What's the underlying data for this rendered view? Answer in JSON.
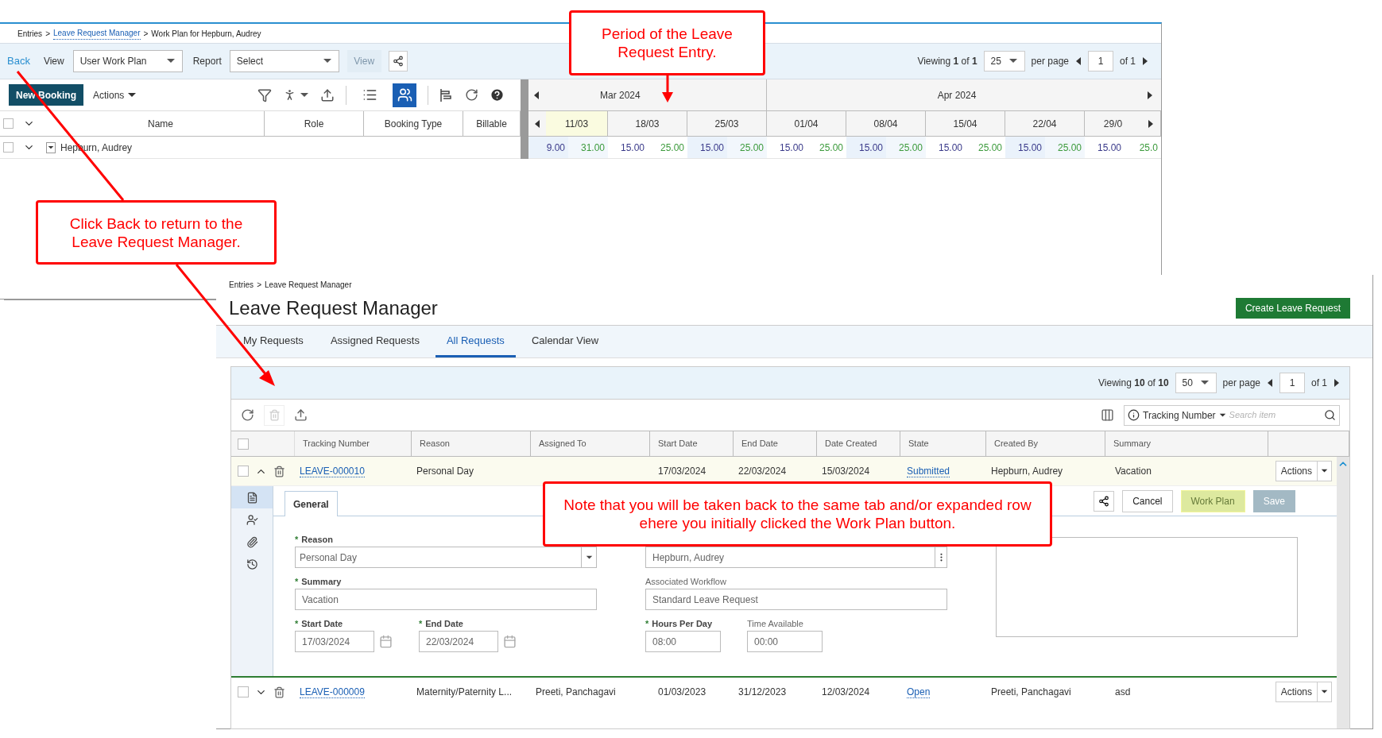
{
  "work_plan": {
    "breadcrumb": [
      {
        "text": "Entries",
        "link": false
      },
      {
        "text": "Leave Request Manager",
        "link": true
      },
      {
        "text": "Work Plan for Hepburn, Audrey",
        "link": false
      }
    ],
    "separator": ">",
    "toolbar": {
      "back": "Back",
      "view_label": "View",
      "view_value": "User Work Plan",
      "report_label": "Report",
      "report_value": "Select",
      "view_button": {
        "label": "View",
        "disabled": true
      }
    },
    "pager": {
      "viewing": "Viewing **1** of **1**",
      "per_page_value": "25",
      "per_page_label": "per page",
      "page": "1",
      "of": "of 1"
    },
    "new_booking": "New Booking",
    "actions": "Actions",
    "view_modes": [
      {
        "selected": false
      },
      {
        "selected": true
      }
    ],
    "columns": [
      "Name",
      "Role",
      "Booking Type",
      "Billable"
    ],
    "months": [
      "Mar 2024",
      "Apr 2024"
    ],
    "weeks": [
      {
        "label": "11/03",
        "current": true,
        "booked": "9.00",
        "available": "31.00"
      },
      {
        "label": "18/03",
        "current": false,
        "booked": "15.00",
        "available": "25.00"
      },
      {
        "label": "25/03",
        "current": false,
        "booked": "15.00",
        "available": "25.00"
      },
      {
        "label": "01/04",
        "current": false,
        "booked": "15.00",
        "available": "25.00"
      },
      {
        "label": "08/04",
        "current": false,
        "booked": "15.00",
        "available": "25.00"
      },
      {
        "label": "15/04",
        "current": false,
        "booked": "15.00",
        "available": "25.00"
      },
      {
        "label": "22/04",
        "current": false,
        "booked": "15.00",
        "available": "25.00"
      },
      {
        "label": "29/0",
        "current": false,
        "booked": "15.00",
        "available": "25.0"
      }
    ],
    "select_all": {
      "checked": false
    },
    "row": {
      "name": "Hepburn, Audrey",
      "checked": false
    }
  },
  "leave_manager": {
    "breadcrumb": [
      {
        "text": "Entries",
        "link": false
      },
      {
        "text": "Leave Request Manager",
        "link": false
      }
    ],
    "separator": ">",
    "title": "Leave Request Manager",
    "create_button": "Create Leave Request",
    "tabs": [
      {
        "label": "My Requests",
        "selected": false
      },
      {
        "label": "Assigned Requests",
        "selected": false
      },
      {
        "label": "All Requests",
        "selected": true
      },
      {
        "label": "Calendar View",
        "selected": false
      }
    ],
    "pager": {
      "viewing": "Viewing **10** of **10**",
      "per_page_value": "50",
      "per_page_label": "per page",
      "page": "1",
      "of": "of 1"
    },
    "search": {
      "field": "Tracking Number",
      "placeholder": "Search item"
    },
    "select_all": {
      "checked": false
    },
    "columns": [
      "Tracking Number",
      "Reason",
      "Assigned To",
      "Start Date",
      "End Date",
      "Date Created",
      "State",
      "Created By",
      "Summary"
    ],
    "rows": [
      {
        "checked": false,
        "expanded": true,
        "tracking": "LEAVE-000010",
        "reason": "Personal Day",
        "start": "17/03/2024",
        "end": "22/03/2024",
        "created": "15/03/2024",
        "state": "Submitted",
        "created_by": "Hepburn, Audrey",
        "summary": "Vacation",
        "actions": "Actions"
      },
      {
        "checked": false,
        "expanded": false,
        "tracking": "LEAVE-000009",
        "reason": "Maternity/Paternity L...",
        "assigned_to": "Preeti, Panchagavi",
        "start": "01/03/2023",
        "end": "31/12/2023",
        "created": "12/03/2024",
        "state": "Open",
        "created_by": "Preeti, Panchagavi",
        "summary": "asd",
        "actions": "Actions"
      }
    ],
    "detail": {
      "side_tabs": [
        {
          "selected": true
        },
        {
          "selected": false
        },
        {
          "selected": false
        },
        {
          "selected": false
        }
      ],
      "tab": {
        "label": "General",
        "selected": true
      },
      "buttons": [
        {
          "label": "Cancel",
          "highlighted": false,
          "disabled": false
        },
        {
          "label": "Work Plan",
          "highlighted": true,
          "disabled": false
        },
        {
          "label": "Save",
          "highlighted": false,
          "disabled": true
        }
      ],
      "required_mark": "*",
      "left": [
        {
          "kind": "select",
          "label": "Reason",
          "required": true,
          "value": "Personal Day"
        },
        {
          "kind": "text",
          "label": "Summary",
          "required": true,
          "value": "Vacation"
        },
        {
          "kind": "pair",
          "fields": [
            {
              "kind": "date",
              "label": "Start Date",
              "required": true,
              "value": "17/03/2024"
            },
            {
              "kind": "date",
              "label": "End Date",
              "required": true,
              "value": "22/03/2024"
            }
          ]
        }
      ],
      "right": [
        {
          "kind": "lookup",
          "value": "Hepburn, Audrey"
        },
        {
          "kind": "text",
          "label": "Associated Workflow",
          "required": false,
          "value": "Standard Leave Request"
        },
        {
          "kind": "pair",
          "fields": [
            {
              "kind": "short",
              "label": "Hours Per Day",
              "required": true,
              "value": "08:00"
            },
            {
              "kind": "short",
              "label": "Time Available",
              "required": false,
              "value": "00:00"
            }
          ]
        }
      ]
    }
  },
  "callouts": [
    {
      "text": "Period of the Leave Request Entry."
    },
    {
      "text": "Click Back to return to the Leave Request Manager."
    },
    {
      "text": "Note that you will be taken back to the same tab and/or expanded row ehere you initially clicked the Work Plan button."
    }
  ]
}
